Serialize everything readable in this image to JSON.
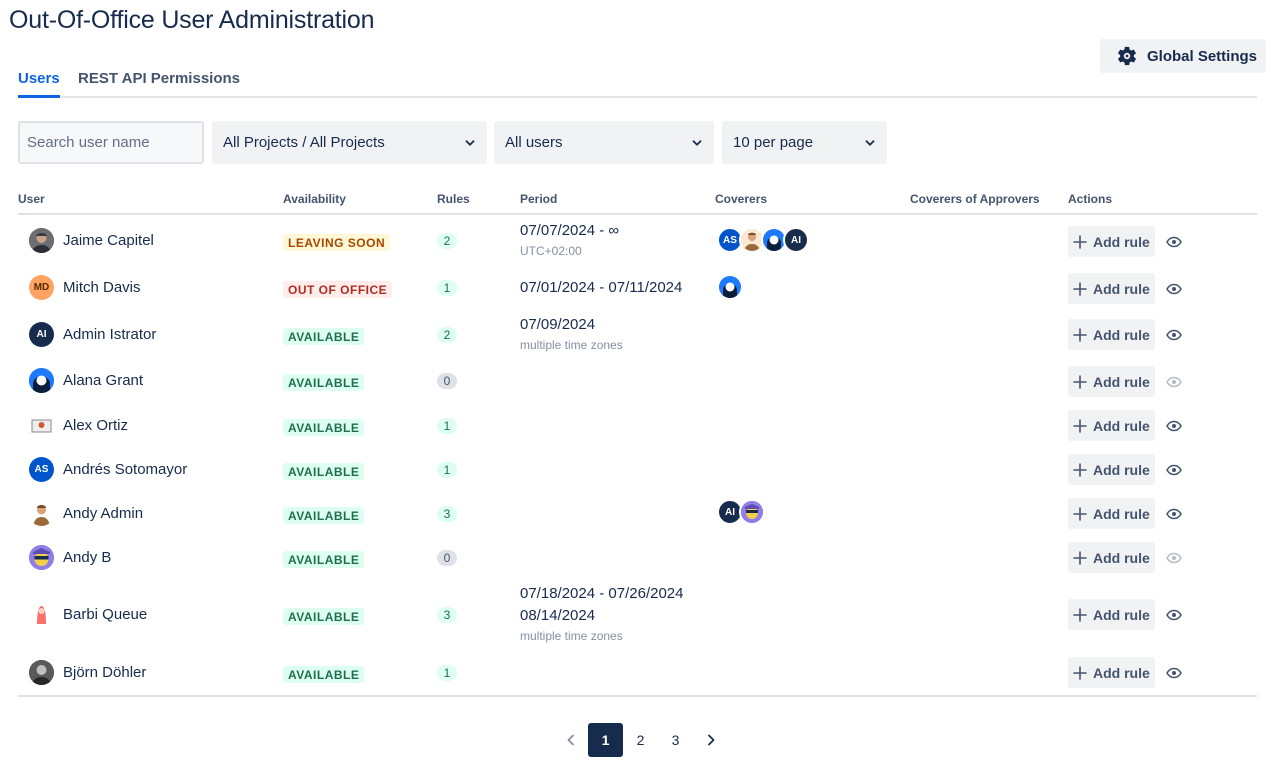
{
  "page": {
    "title": "Out-Of-Office User Administration"
  },
  "global_settings": {
    "label": "Global Settings",
    "icon": "gear-icon"
  },
  "tabs": [
    {
      "label": "Users",
      "active": true
    },
    {
      "label": "REST API Permissions",
      "active": false
    }
  ],
  "filters": {
    "search_placeholder": "Search user name",
    "search_value": "",
    "project": "All Projects / All Projects",
    "users": "All users",
    "per_page": "10 per page"
  },
  "table": {
    "headers": {
      "user": "User",
      "availability": "Availability",
      "rules": "Rules",
      "period": "Period",
      "coverers": "Coverers",
      "coverers_of_approvers": "Coverers of Approvers",
      "actions": "Actions"
    },
    "add_rule_label": "Add rule",
    "rows": [
      {
        "name": "Jaime Capitel",
        "availability": "LEAVING SOON",
        "rules": "2",
        "period": "07/07/2024 - ∞",
        "period_sub": "UTC+02:00",
        "coverers": [
          "AS",
          "Andy Admin",
          "Alana Grant",
          "AI"
        ]
      },
      {
        "name": "Mitch Davis",
        "initials": "MD",
        "availability": "OUT OF OFFICE",
        "rules": "1",
        "period": "07/01/2024 - 07/11/2024",
        "coverers": [
          "Alana Grant"
        ]
      },
      {
        "name": "Admin Istrator",
        "initials": "AI",
        "availability": "AVAILABLE",
        "rules": "2",
        "period": "07/09/2024",
        "period_sub": "multiple time zones"
      },
      {
        "name": "Alana Grant",
        "availability": "AVAILABLE",
        "rules": "0"
      },
      {
        "name": "Alex Ortiz",
        "availability": "AVAILABLE",
        "rules": "1"
      },
      {
        "name": "Andrés Sotomayor",
        "initials": "AS",
        "availability": "AVAILABLE",
        "rules": "1"
      },
      {
        "name": "Andy Admin",
        "availability": "AVAILABLE",
        "rules": "3",
        "coverers": [
          "AI",
          "Andy B"
        ]
      },
      {
        "name": "Andy B",
        "availability": "AVAILABLE",
        "rules": "0"
      },
      {
        "name": "Barbi Queue",
        "availability": "AVAILABLE",
        "rules": "3",
        "period": "07/18/2024 - 07/26/2024",
        "period2": "08/14/2024",
        "period_sub": "multiple time zones"
      },
      {
        "name": "Björn Döhler",
        "availability": "AVAILABLE",
        "rules": "1"
      }
    ]
  },
  "pagination": {
    "pages": [
      "1",
      "2",
      "3"
    ],
    "current": "1"
  },
  "colors": {
    "accent": "#0c66e4",
    "text": "#172b4d",
    "available": "#216e4e",
    "leaving": "#a54800",
    "out": "#ae2e24"
  }
}
